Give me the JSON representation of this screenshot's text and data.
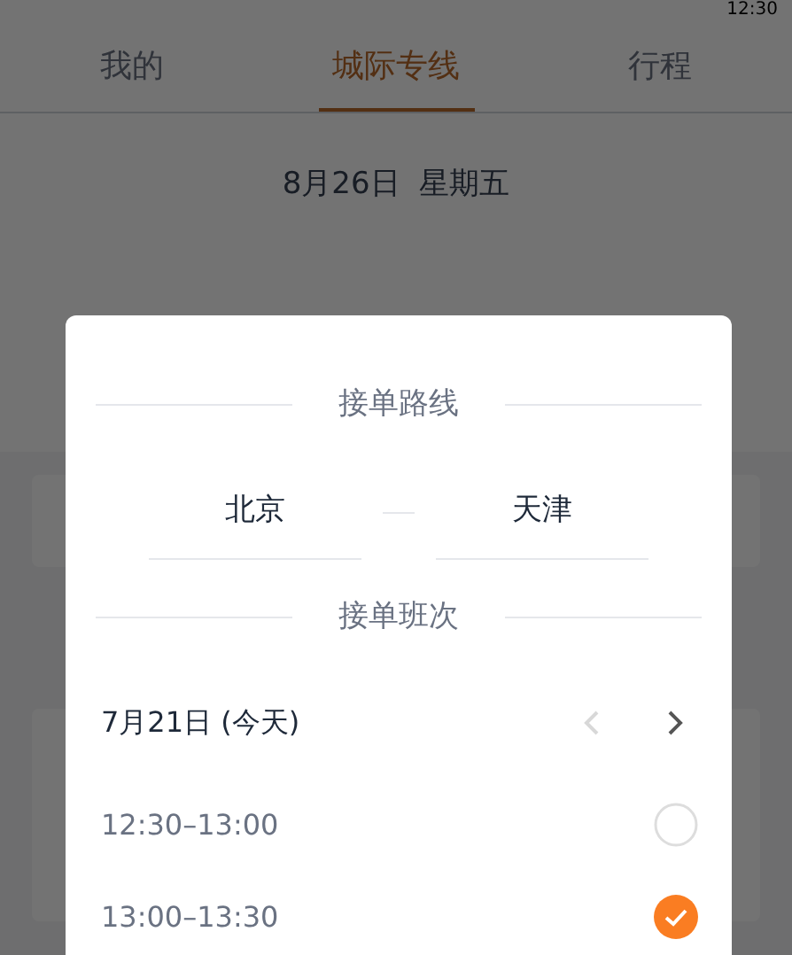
{
  "status_bar": {
    "time": "12:30"
  },
  "tabs": [
    {
      "label": "我的",
      "selected": false
    },
    {
      "label": "城际专线",
      "selected": true
    },
    {
      "label": "行程",
      "selected": false
    }
  ],
  "date": "8月26日  星期五",
  "dialog": {
    "route_title": "接单路线",
    "from": "北京",
    "to": "天津",
    "schedule_title": "接单班次",
    "day_label": "7月21日 (今天)",
    "prev_disabled": true,
    "next_disabled": false,
    "slots": [
      {
        "time": "12:30–13:00",
        "selected": false
      },
      {
        "time": "13:00–13:30",
        "selected": true
      }
    ]
  }
}
